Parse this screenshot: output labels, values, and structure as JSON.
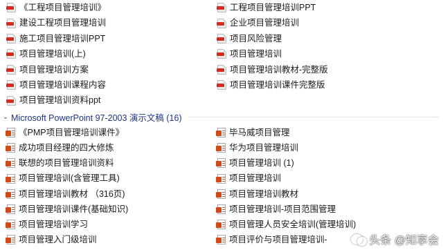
{
  "pdf_files": [
    {
      "name": "《工程项目管理培训》",
      "icon": "pdf-icon"
    },
    {
      "name": "工程项目管理培训PPT",
      "icon": "pdf-icon"
    },
    {
      "name": "建设工程项目管理培训",
      "icon": "pdf-icon"
    },
    {
      "name": "企业项目管理培训",
      "icon": "pdf-icon"
    },
    {
      "name": "施工项目管理培训PPT",
      "icon": "pdf-icon"
    },
    {
      "name": "项目风险管理",
      "icon": "pdf-icon"
    },
    {
      "name": "项目管理培训(上)",
      "icon": "pdf-icon"
    },
    {
      "name": "项目管理培训",
      "icon": "pdf-icon"
    },
    {
      "name": "项目管理培训方案",
      "icon": "pdf-icon"
    },
    {
      "name": "项目管理培训教材-完整版",
      "icon": "pdf-icon"
    },
    {
      "name": "项目管理培训课程内容",
      "icon": "pdf-icon"
    },
    {
      "name": "项目管理培训课件完整版",
      "icon": "pdf-icon"
    },
    {
      "name": "项目管理培训资料ppt",
      "icon": "pdf-icon"
    }
  ],
  "group": {
    "title": "Microsoft PowerPoint 97-2003 演示文稿 (16)",
    "collapse_icon": "chevron-down-icon"
  },
  "ppt_files": [
    {
      "name": "《PMP项目管理培训课件》",
      "icon": "ppt-icon"
    },
    {
      "name": "毕马威项目管理",
      "icon": "ppt-icon"
    },
    {
      "name": "成功项目经理的四大修炼",
      "icon": "ppt-icon"
    },
    {
      "name": "华为项目管理培训",
      "icon": "ppt-icon"
    },
    {
      "name": "联想的项目管理培训资料",
      "icon": "ppt-icon"
    },
    {
      "name": "项目管理培训 (1)",
      "icon": "ppt-icon"
    },
    {
      "name": "项目管理培训(含管理工具)",
      "icon": "ppt-icon"
    },
    {
      "name": "项目管理培训",
      "icon": "ppt-icon"
    },
    {
      "name": "项目管理培训教材 （316页)",
      "icon": "ppt-icon"
    },
    {
      "name": "项目管理培训教材",
      "icon": "ppt-icon"
    },
    {
      "name": "项目管理培训课件(基础知识)",
      "icon": "ppt-icon"
    },
    {
      "name": "项目管理培训-项目范围管理",
      "icon": "ppt-icon"
    },
    {
      "name": "项目管理培训学习",
      "icon": "ppt-icon"
    },
    {
      "name": "项目管理人员安全培训(管理培训)",
      "icon": "ppt-icon"
    },
    {
      "name": "项目管理入门级培训",
      "icon": "ppt-icon"
    },
    {
      "name": "项目评价与项目管理培训-",
      "icon": "ppt-icon"
    }
  ],
  "watermark": {
    "text": "头条 @知享会",
    "logo": "zhixianghui-logo"
  }
}
